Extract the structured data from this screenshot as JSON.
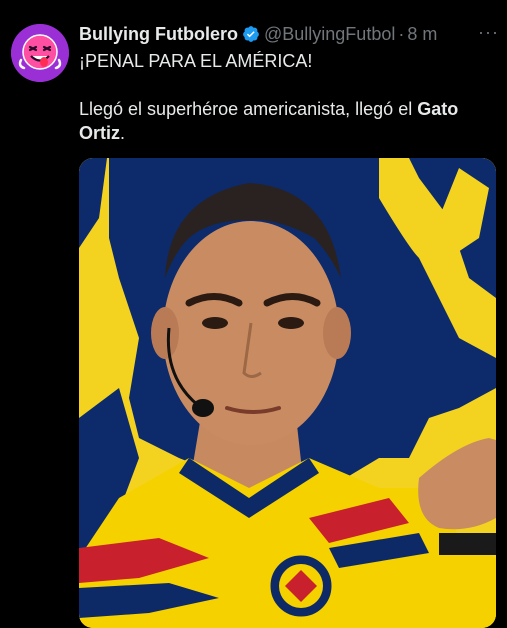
{
  "tweet": {
    "display_name": "Bullying Futbolero",
    "handle": "@BullyingFutbol",
    "separator": "·",
    "time": "8 m",
    "more": "···",
    "line1": "¡PENAL PARA EL AMÉRICA!",
    "line2_prefix": "Llegó el superhéroe americanista, llegó el ",
    "line2_bold": "Gato",
    "line3_bold": "Ortiz",
    "line3_suffix": "."
  },
  "colors": {
    "background": "#000000",
    "text": "#e7e9ea",
    "muted": "#71767b",
    "verified": "#1d9bf0",
    "avatar": "#9b2fd6"
  },
  "icons": {
    "verified": "verified-badge-icon",
    "more": "more-options-icon"
  }
}
